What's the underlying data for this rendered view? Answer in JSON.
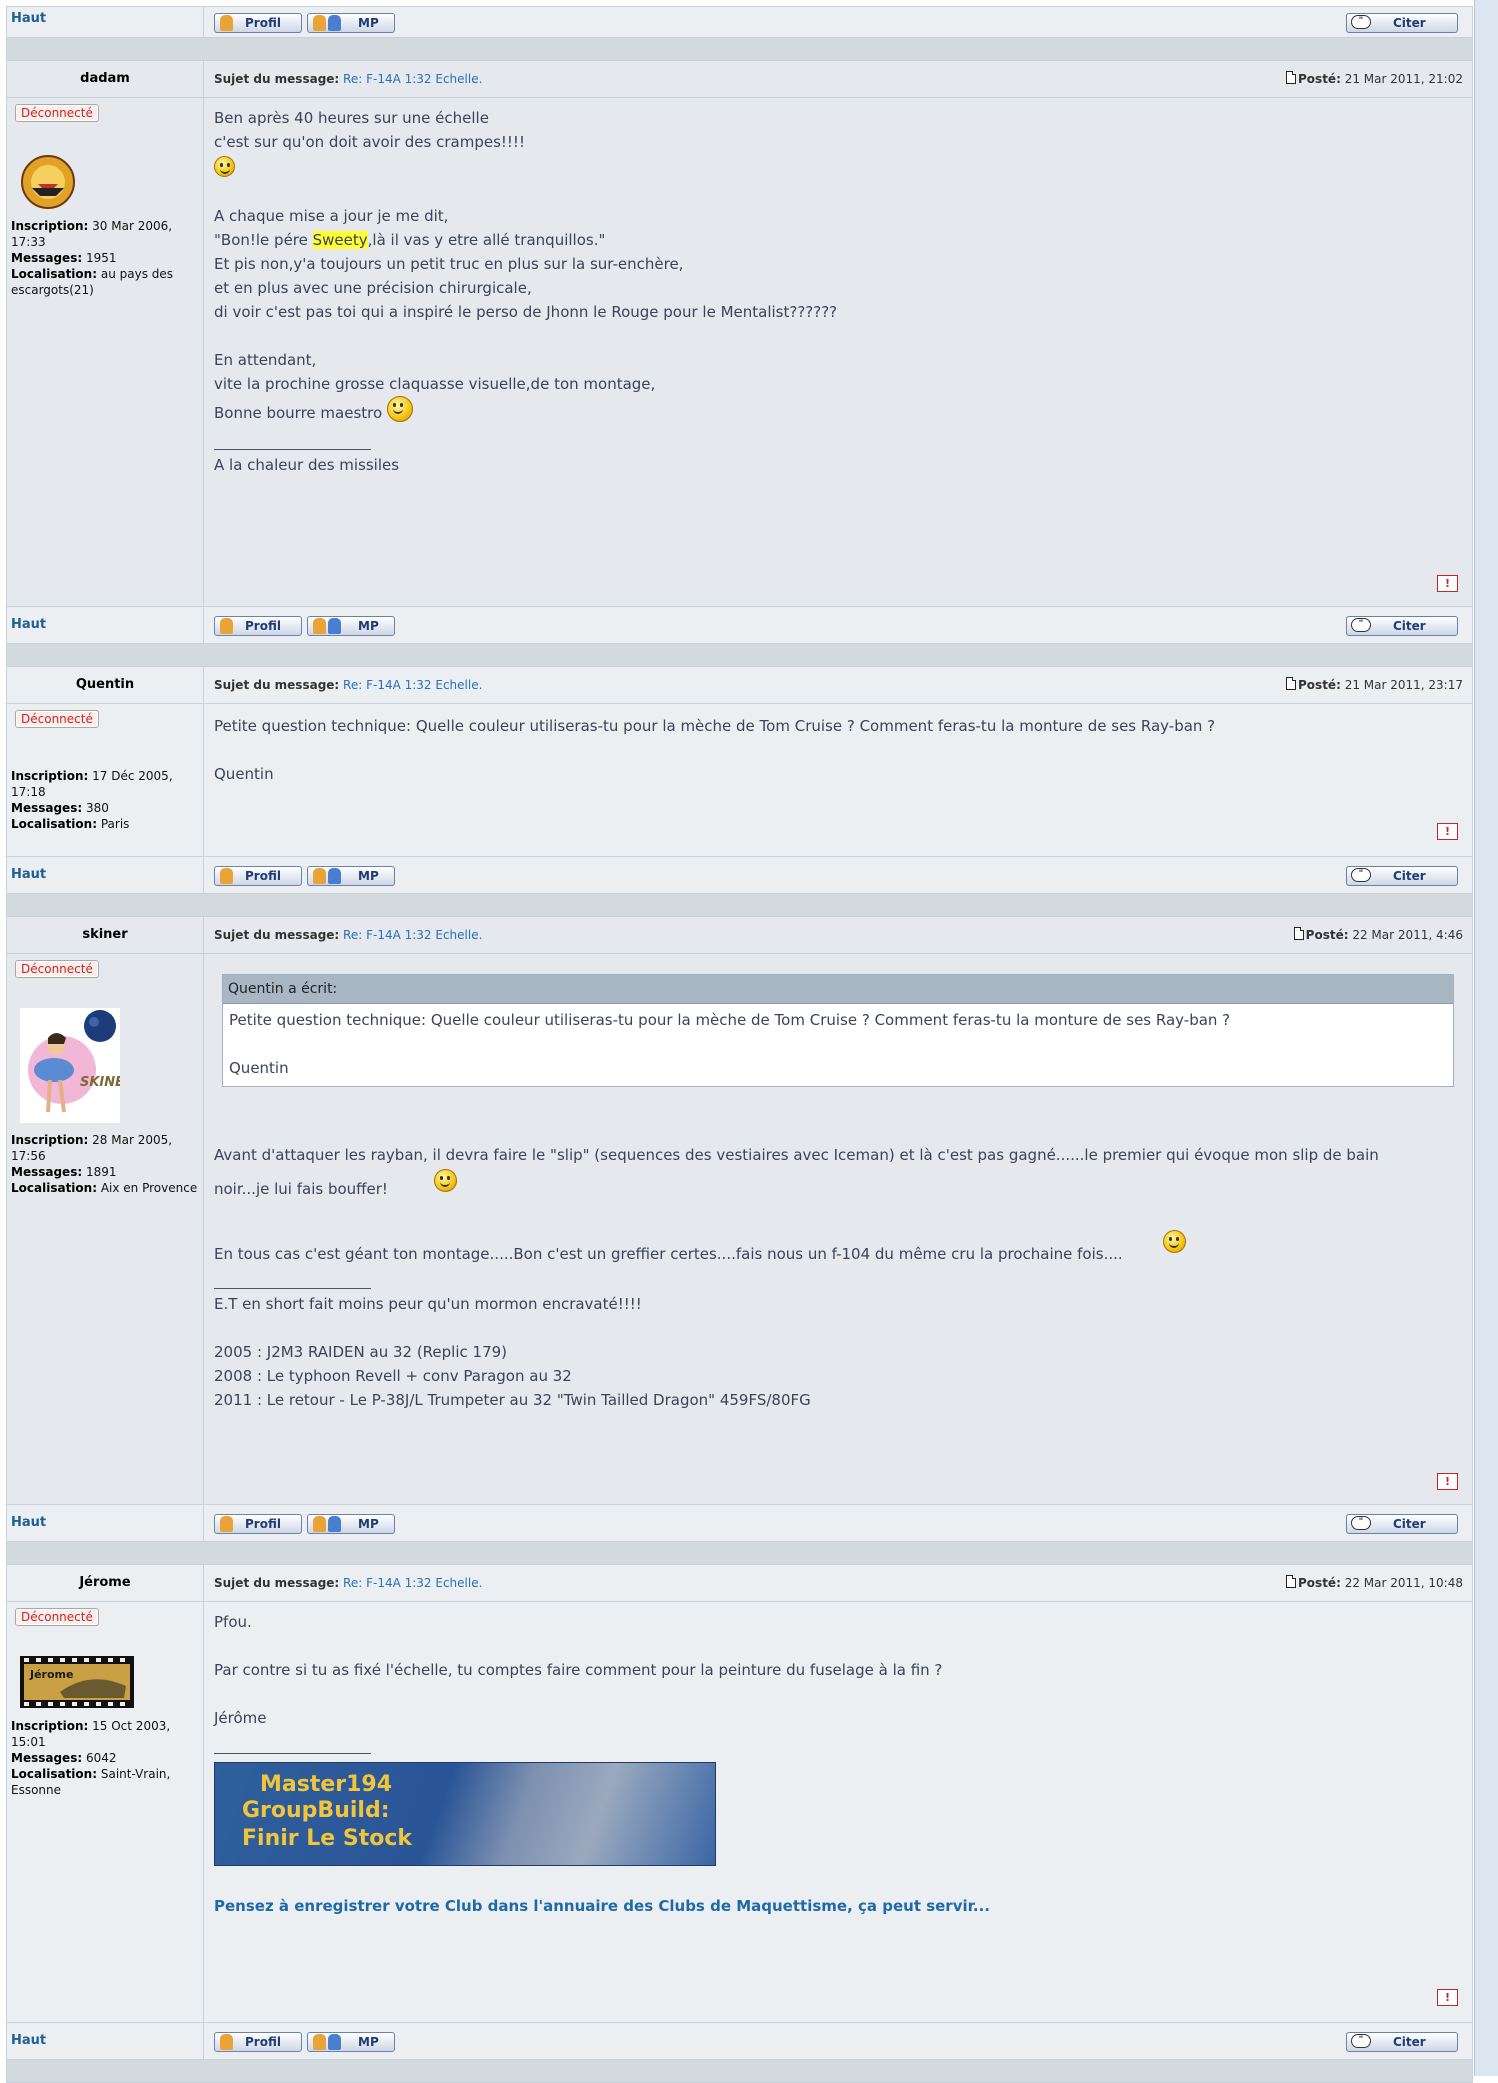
{
  "ui": {
    "haut": "Haut",
    "profil": "Profil",
    "mp": "MP",
    "citer": "Citer",
    "subject_label": "Sujet du message:",
    "posted_label": "Posté:",
    "offline": "Déconnecté",
    "inscription_label": "Inscription:",
    "messages_label": "Messages:",
    "localisation_label": "Localisation:",
    "report": "!"
  },
  "posts": [
    {
      "author": "dadam",
      "subject": "Re: F-14A 1:32 Echelle.",
      "posted": "21 Mar 2011, 21:02",
      "inscription": "30 Mar 2006, 17:33",
      "messages": "1951",
      "localisation": "au pays des escargots(21)",
      "body": {
        "l1": "Ben après 40 heures sur une échelle",
        "l2": "c'est sur qu'on doit avoir des crampes!!!!",
        "l3": "A chaque mise a jour je me dit,",
        "l4a": "\"Bon!le pére ",
        "l4hl": "Sweety",
        "l4b": ",là il vas y etre allé tranquillos.\"",
        "l5": "Et pis non,y'a toujours un petit truc en plus sur la sur-enchère,",
        "l6": "et en plus avec une précision chirurgicale,",
        "l7": "di voir c'est pas toi qui a inspiré le perso de Jhonn le Rouge pour le Mentalist??????",
        "l8": "En attendant,",
        "l9": "vite la prochine grosse claquasse visuelle,de ton montage,",
        "l10": "Bonne bourre maestro",
        "sig": "A la chaleur des missiles"
      }
    },
    {
      "author": "Quentin",
      "subject": "Re: F-14A 1:32 Echelle.",
      "posted": "21 Mar 2011, 23:17",
      "inscription": "17 Déc 2005, 17:18",
      "messages": "380",
      "localisation": "Paris",
      "body": {
        "l1": "Petite question technique: Quelle couleur utiliseras-tu pour la mèche de Tom Cruise ? Comment feras-tu la monture de ses Ray-ban ?",
        "l2": "Quentin"
      }
    },
    {
      "author": "skiner",
      "subject": "Re: F-14A 1:32 Echelle.",
      "posted": "22 Mar 2011, 4:46",
      "inscription": "28 Mar 2005, 17:56",
      "messages": "1891",
      "localisation": "Aix en Provence",
      "quote": {
        "head": "Quentin a écrit:",
        "l1": "Petite question technique: Quelle couleur utiliseras-tu pour la mèche de Tom Cruise ? Comment feras-tu la monture de ses Ray-ban ?",
        "l2": "Quentin"
      },
      "body": {
        "l1": "Avant d'attaquer les rayban, il devra faire le \"slip\" (sequences des vestiaires avec Iceman) et là c'est pas gagné......le premier qui évoque mon slip de bain",
        "l2": "noir...je lui fais bouffer!",
        "l3": "En tous cas c'est géant ton montage.....Bon c'est un greffier certes....fais nous un f-104 du même cru la prochaine fois....",
        "sig1": "E.T en short fait moins peur qu'un mormon encravaté!!!!",
        "sig2": "2005 : J2M3 RAIDEN au 32 (Replic 179)",
        "sig3": "2008 : Le typhoon Revell + conv Paragon au 32",
        "sig4": "2011 : Le retour - Le P-38J/L Trumpeter au 32 \"Twin Tailled Dragon\" 459FS/80FG"
      }
    },
    {
      "author": "Jérome",
      "subject": "Re: F-14A 1:32 Echelle.",
      "posted": "22 Mar 2011, 10:48",
      "inscription": "15 Oct 2003, 15:01",
      "messages": "6042",
      "localisation": "Saint-Vrain, Essonne",
      "avatar_text": "Jérome",
      "body": {
        "l1": "Pfou.",
        "l2": "Par contre si tu as fixé l'échelle, tu comptes faire comment pour la peinture du fuselage à la fin ?",
        "l3": "Jérôme",
        "banner1": "Master194",
        "banner2": "GroupBuild:",
        "banner3": "Finir Le Stock",
        "link": "Pensez à enregistrer votre Club dans l'annuaire des Clubs de Maquettisme, ça peut servir..."
      }
    }
  ]
}
